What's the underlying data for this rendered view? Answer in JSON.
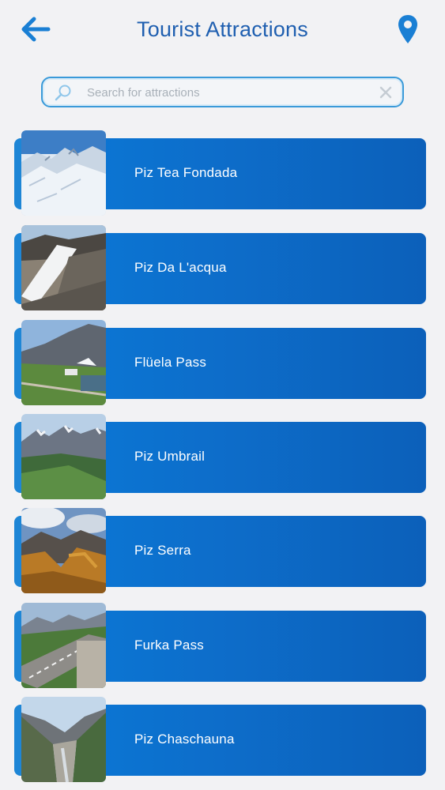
{
  "header": {
    "title": "Tourist Attractions",
    "back_icon": "arrow-left-icon",
    "location_icon": "map-pin-icon",
    "accent_color": "#1a7fd4"
  },
  "search": {
    "placeholder": "Search for attractions",
    "value": ""
  },
  "attractions": [
    {
      "name": "Piz Tea Fondada",
      "thumb": "snowy-glacier"
    },
    {
      "name": "Piz Da L'acqua",
      "thumb": "rocky-ridge"
    },
    {
      "name": "Flüela Pass",
      "thumb": "mountain-pass-road"
    },
    {
      "name": "Piz Umbrail",
      "thumb": "green-valley-peaks"
    },
    {
      "name": "Piz Serra",
      "thumb": "autumn-forest-peaks"
    },
    {
      "name": "Furka Pass",
      "thumb": "winding-road"
    },
    {
      "name": "Piz Chaschauna",
      "thumb": "river-valley"
    }
  ]
}
